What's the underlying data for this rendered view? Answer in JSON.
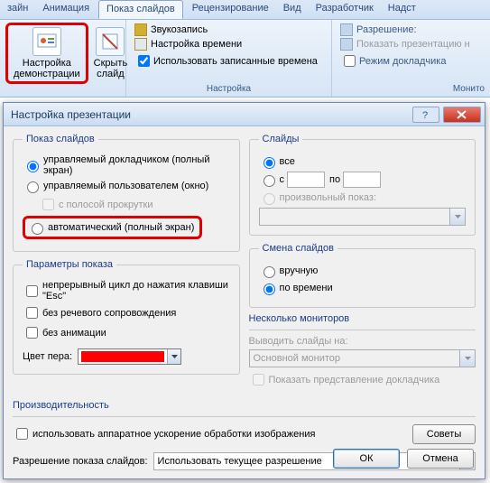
{
  "ribbon_tabs": {
    "design": "зайн",
    "animation": "Анимация",
    "slideshow": "Показ слайдов",
    "review": "Рецензирование",
    "view": "Вид",
    "developer": "Разработчик",
    "addins": "Надст"
  },
  "ribbon": {
    "setup_btn_l1": "Настройка",
    "setup_btn_l2": "демонстрации",
    "hide_btn_l1": "Скрыть",
    "hide_btn_l2": "слайд",
    "record_sound": "Звукозапись",
    "rehearse": "Настройка времени",
    "use_recorded": "Использовать записанные времена",
    "group_setup": "Настройка",
    "resolution_label": "Разрешение:",
    "show_on_label": "Показать презентацию н",
    "presenter_view": "Режим докладчика",
    "group_monitor": "Монито"
  },
  "dialog": {
    "title": "Настройка презентации",
    "groups": {
      "show_type": "Показ слайдов",
      "slides": "Слайды",
      "options": "Параметры показа",
      "advance": "Смена слайдов",
      "monitors": "Несколько мониторов",
      "performance": "Производительность"
    },
    "show_type": {
      "presenter": "управляемый докладчиком (полный экран)",
      "browsed_user": "управляемый пользователем (окно)",
      "scrollbar": "с полосой прокрутки",
      "kiosk": "автоматический (полный экран)"
    },
    "slides": {
      "all": "все",
      "from": "с",
      "to": "по",
      "custom": "произвольный показ:"
    },
    "options": {
      "loop": "непрерывный цикл до нажатия клавиши \"Esc\"",
      "no_narration": "без речевого сопровождения",
      "no_animation": "без анимации",
      "pen_color": "Цвет пера:"
    },
    "advance": {
      "manual": "вручную",
      "timings": "по времени"
    },
    "monitors": {
      "display_on": "Выводить слайды на:",
      "primary": "Основной монитор",
      "presenter_view": "Показать представление докладчика"
    },
    "performance": {
      "hw_accel": "использовать аппаратное ускорение обработки изображения",
      "tips": "Советы",
      "resolution_label": "Разрешение показа слайдов:",
      "resolution_value": "Использовать текущее разрешение"
    },
    "buttons": {
      "ok": "ОК",
      "cancel": "Отмена"
    }
  }
}
